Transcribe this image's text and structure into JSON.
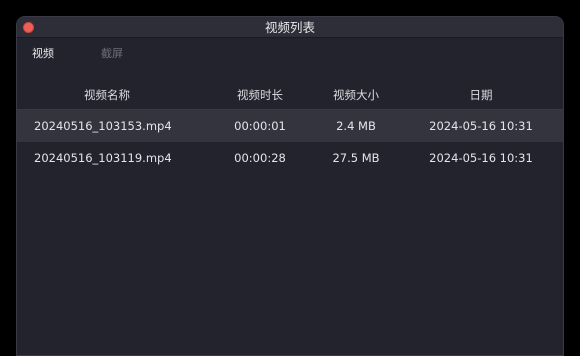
{
  "window": {
    "title": "视频列表"
  },
  "tabs": [
    {
      "label": "视频",
      "active": true
    },
    {
      "label": "截屏",
      "active": false
    }
  ],
  "table": {
    "columns": [
      "视频名称",
      "视频时长",
      "视频大小",
      "日期"
    ],
    "rows": [
      {
        "name": "20240516_103153.mp4",
        "duration": "00:00:01",
        "size": "2.4 MB",
        "date": "2024-05-16 10:31",
        "selected": true
      },
      {
        "name": "20240516_103119.mp4",
        "duration": "00:00:28",
        "size": "27.5 MB",
        "date": "2024-05-16 10:31",
        "selected": false
      }
    ]
  },
  "colors": {
    "close": "#ee5f56",
    "window_bg": "#23232d",
    "selected_row": "#34343f"
  }
}
